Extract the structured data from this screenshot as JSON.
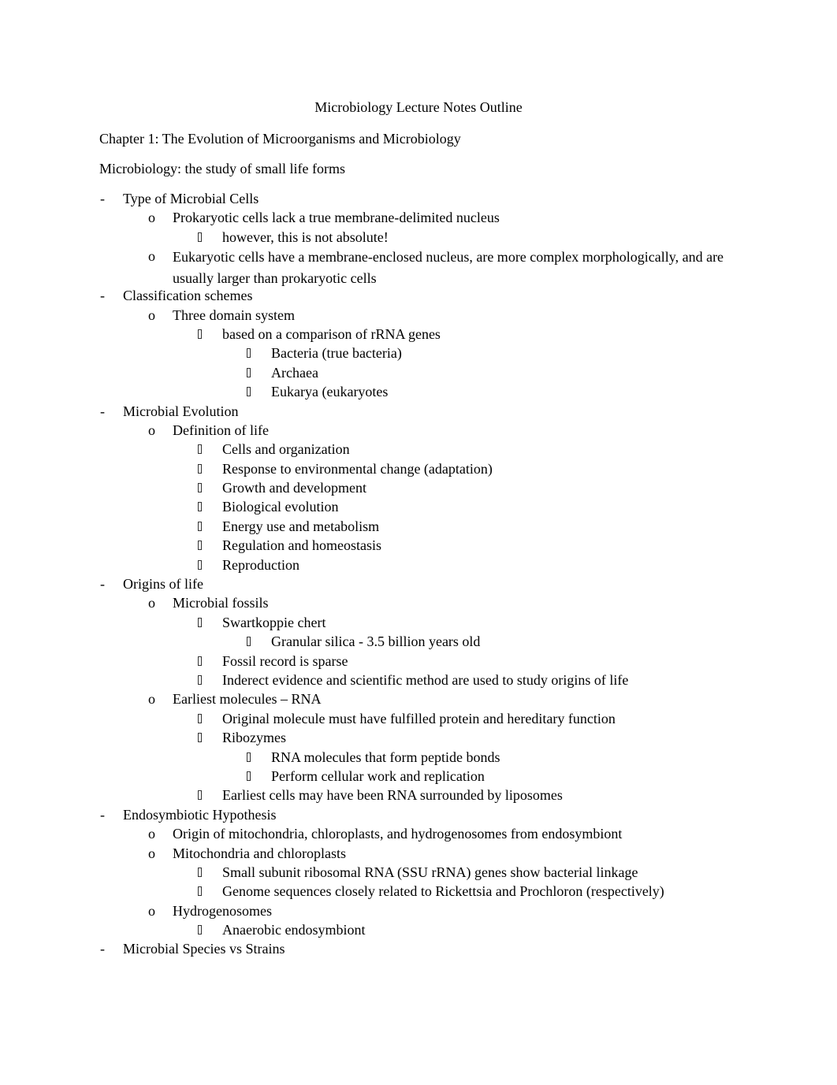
{
  "document": {
    "title": "Microbiology Lecture Notes Outline",
    "chapter": "Chapter 1: The Evolution of Microorganisms and Microbiology",
    "definition": "Microbiology: the study of small life forms",
    "markers": {
      "level1": "-",
      "level2": "o",
      "level3": "missing-glyph-box",
      "level4": "missing-glyph-box"
    },
    "outline": [
      {
        "level": 1,
        "text": "Type of Microbial Cells"
      },
      {
        "level": 2,
        "text": "Prokaryotic cells lack a true membrane-delimited nucleus"
      },
      {
        "level": 3,
        "text": "however, this is not  absolute!"
      },
      {
        "level": 2,
        "text": "Eukaryotic cells have a membrane-enclosed nucleus, are more complex morphologically, and are usually larger than prokaryotic cells",
        "wrap": true
      },
      {
        "level": 1,
        "text": "Classification schemes"
      },
      {
        "level": 2,
        "text": "Three domain system"
      },
      {
        "level": 3,
        "text": "based on a comparison of rRNA genes"
      },
      {
        "level": 4,
        "text": "Bacteria (true bacteria)"
      },
      {
        "level": 4,
        "text": "Archaea"
      },
      {
        "level": 4,
        "text": "Eukarya (eukaryotes"
      },
      {
        "level": 1,
        "text": "Microbial Evolution"
      },
      {
        "level": 2,
        "text": "Definition of life"
      },
      {
        "level": 3,
        "text": "Cells and organization"
      },
      {
        "level": 3,
        "text": "Response to environmental change (adaptation)"
      },
      {
        "level": 3,
        "text": "Growth and development"
      },
      {
        "level": 3,
        "text": "Biological evolution"
      },
      {
        "level": 3,
        "text": "Energy use and metabolism"
      },
      {
        "level": 3,
        "text": "Regulation and homeostasis"
      },
      {
        "level": 3,
        "text": "Reproduction"
      },
      {
        "level": 1,
        "text": "Origins of life"
      },
      {
        "level": 2,
        "text": "Microbial fossils"
      },
      {
        "level": 3,
        "text": "Swartkoppie chert"
      },
      {
        "level": 4,
        "text": "Granular silica - 3.5 billion years old"
      },
      {
        "level": 3,
        "text": "Fossil record is sparse"
      },
      {
        "level": 3,
        "text": "Inderect evidence and scientific method are used to study origins of life"
      },
      {
        "level": 2,
        "text": "Earliest molecules – RNA"
      },
      {
        "level": 3,
        "text": "Original molecule must have fulfilled protein and  hereditary function"
      },
      {
        "level": 3,
        "text": "Ribozymes"
      },
      {
        "level": 4,
        "text": "RNA molecules that form peptide bonds"
      },
      {
        "level": 4,
        "text": "Perform cellular work and replication"
      },
      {
        "level": 3,
        "text": "Earliest cells may have been RNA surrounded by liposomes"
      },
      {
        "level": 1,
        "text": "Endosymbiotic Hypothesis"
      },
      {
        "level": 2,
        "text": "Origin of mitochondria, chloroplasts, and hydrogenosomes from endosymbiont"
      },
      {
        "level": 2,
        "text": "Mitochondria and chloroplasts"
      },
      {
        "level": 3,
        "text": "Small subunit ribosomal RNA (SSU rRNA) genes show bacterial linkage"
      },
      {
        "level": 3,
        "text": "Genome sequences closely related to   Rickettsia and Prochloron (respectively)"
      },
      {
        "level": 2,
        "text": "Hydrogenosomes"
      },
      {
        "level": 3,
        "text": "Anaerobic endosymbiont"
      },
      {
        "level": 1,
        "text": "Microbial Species vs Strains"
      }
    ]
  }
}
